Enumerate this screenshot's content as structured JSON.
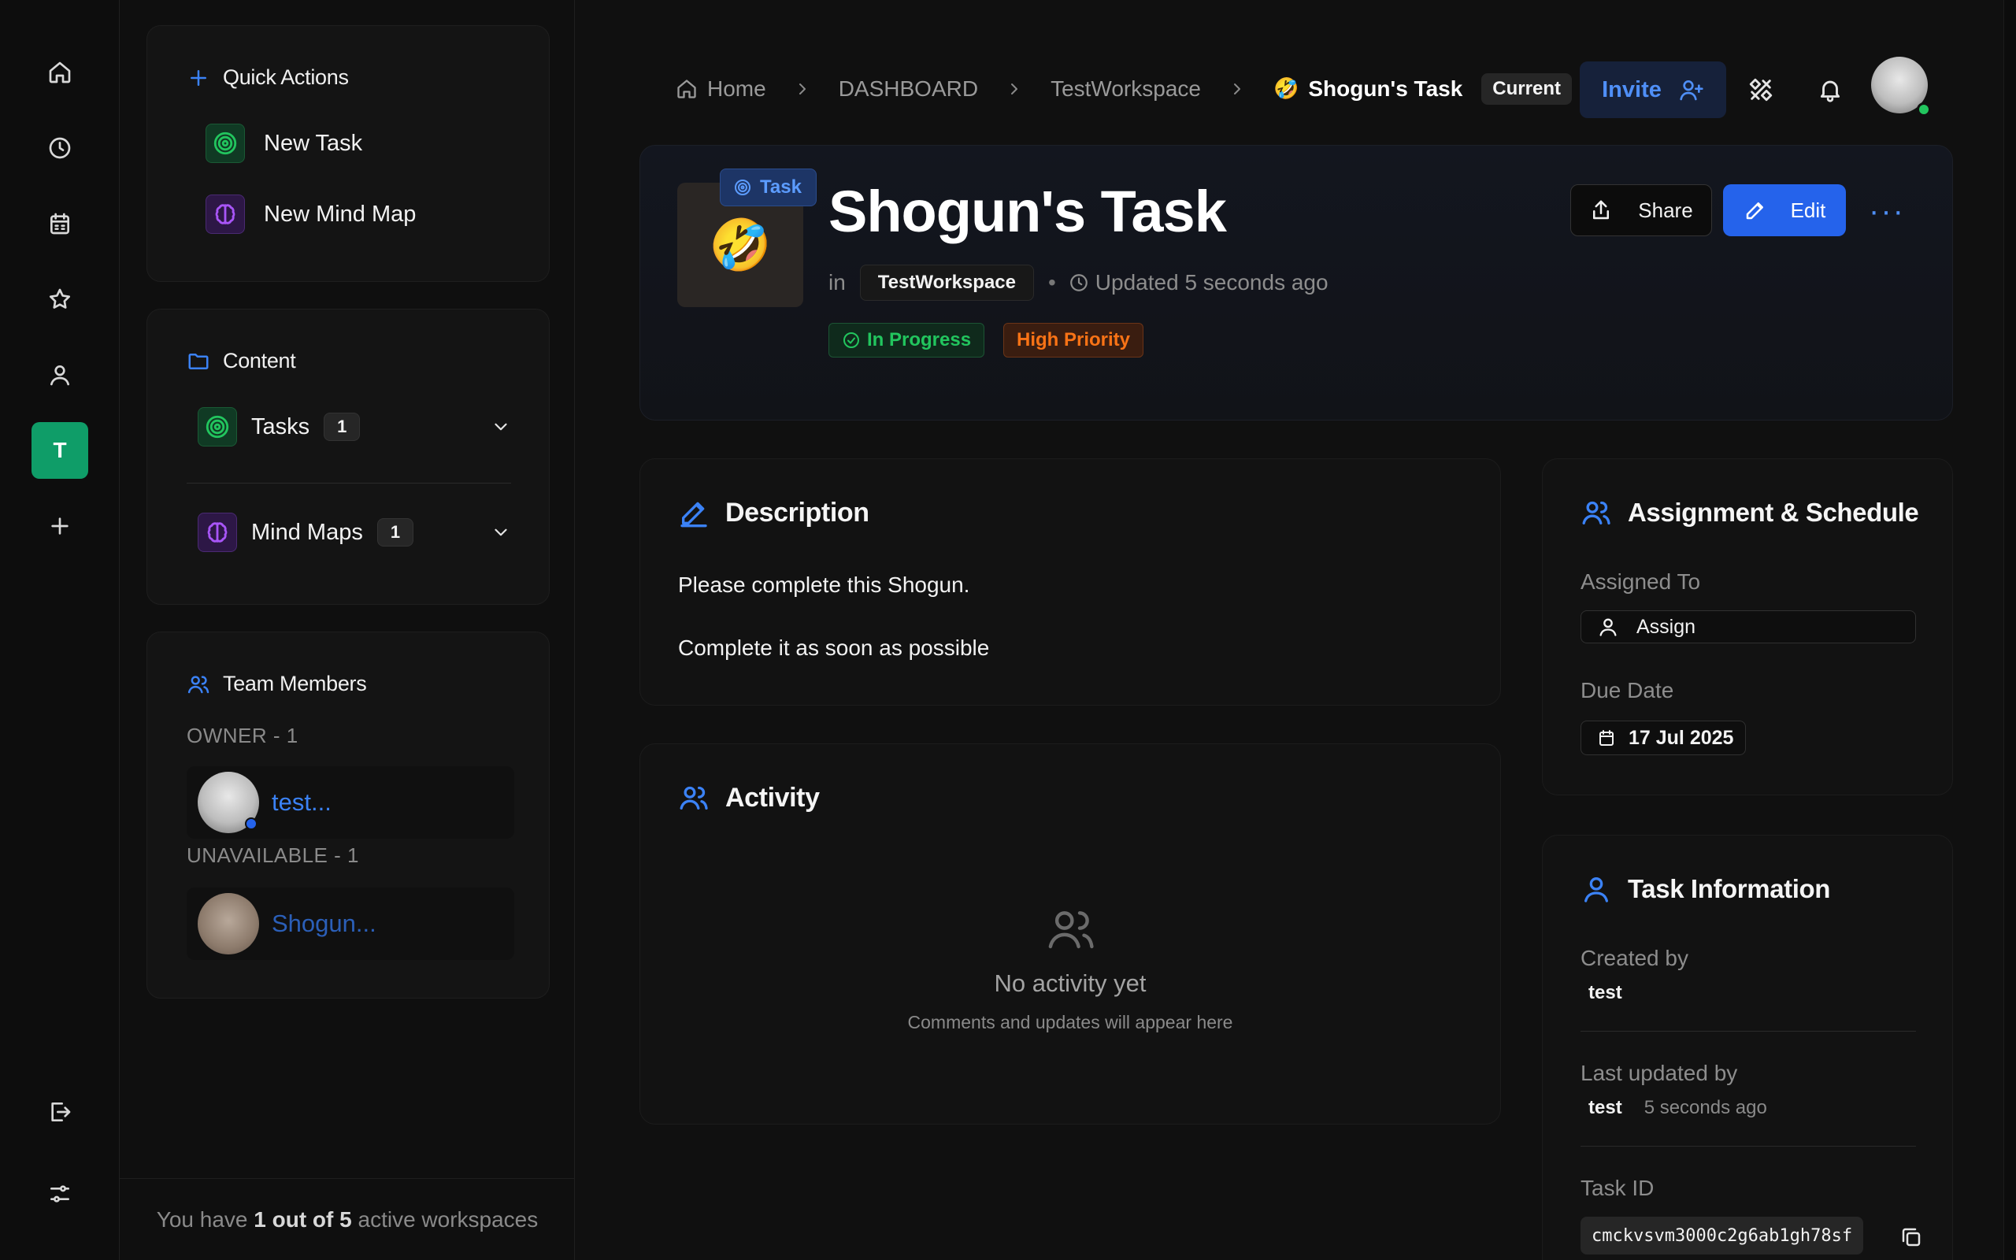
{
  "rail": {
    "workspace_initial": "T"
  },
  "sidebar": {
    "quick_actions": {
      "title": "Quick Actions",
      "new_task": "New Task",
      "new_mind_map": "New Mind Map"
    },
    "content": {
      "title": "Content",
      "tasks_label": "Tasks",
      "tasks_count": "1",
      "mindmaps_label": "Mind Maps",
      "mindmaps_count": "1"
    },
    "team": {
      "title": "Team Members",
      "owner_label": "OWNER - 1",
      "owner_name": "test...",
      "unavailable_label": "UNAVAILABLE - 1",
      "unavailable_name": "Shogun..."
    },
    "footer": {
      "prefix": "You have",
      "count": "1 out of 5",
      "suffix": "active workspaces"
    }
  },
  "breadcrumb": {
    "home": "Home",
    "dashboard": "DASHBOARD",
    "workspace": "TestWorkspace",
    "current_emoji": "🤣",
    "current": "Shogun's Task",
    "current_tag": "Current"
  },
  "header": {
    "invite_label": "Invite"
  },
  "task": {
    "type_tag": "Task",
    "emoji": "🤣",
    "title": "Shogun's Task",
    "in_label": "in",
    "workspace": "TestWorkspace",
    "updated": "Updated 5 seconds ago",
    "status": "In Progress",
    "priority": "High Priority",
    "share_label": "Share",
    "edit_label": "Edit",
    "more_label": "···"
  },
  "description": {
    "title": "Description",
    "line1": "Please complete this Shogun.",
    "line2": "Complete it as soon as possible"
  },
  "activity": {
    "title": "Activity",
    "empty_title": "No activity yet",
    "empty_sub": "Comments and updates will appear here"
  },
  "assignment": {
    "title": "Assignment & Schedule",
    "assigned_label": "Assigned To",
    "assign_button": "Assign",
    "due_label": "Due Date",
    "due_value": "17 Jul 2025"
  },
  "info": {
    "title": "Task Information",
    "created_label": "Created by",
    "created_value": "test",
    "updated_label": "Last updated by",
    "updated_value": "test",
    "updated_time": "5 seconds ago",
    "id_label": "Task ID",
    "id_value": "cmckvsvm3000c2g6ab1gh78sf"
  },
  "colors": {
    "accent": "#3b82f6",
    "workspace_badge": "#0f9d68",
    "status_green": "#22c55e",
    "priority_orange": "#f97316",
    "online": "#22c55e"
  }
}
